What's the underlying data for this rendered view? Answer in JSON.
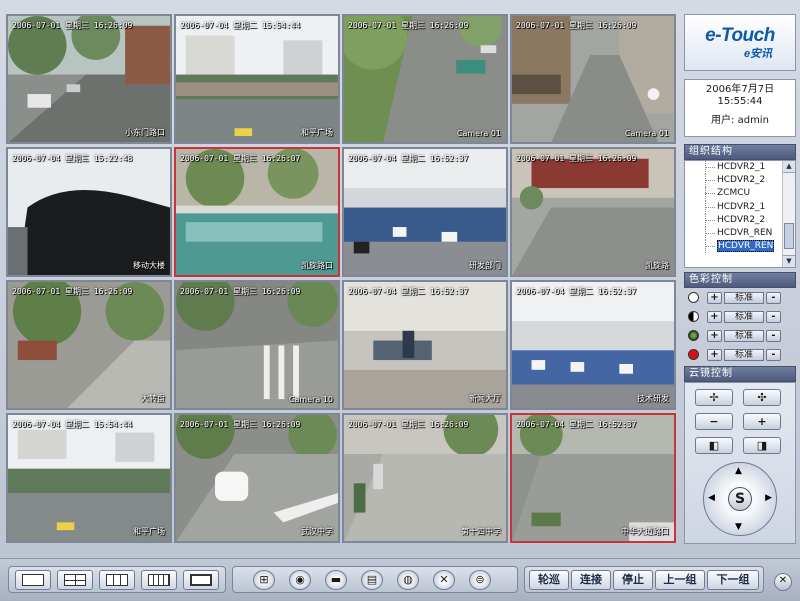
{
  "cameras": [
    {
      "timestamp": "2006-07-01  星期三  16:26:09",
      "name": "小东门路口"
    },
    {
      "timestamp": "2006-07-04  星期二  15:54:44",
      "name": "和平广场"
    },
    {
      "timestamp": "2006-07-01  星期三  16:26:09",
      "name": "Camera 01"
    },
    {
      "timestamp": "2006-07-01  星期三  16:26:09",
      "name": "Camera 01"
    },
    {
      "timestamp": "2006-07-04  星期三  15:22:48",
      "name": "移动大楼"
    },
    {
      "timestamp": "2006-07-01  星期三  16:26:07",
      "name": "凯旋路口"
    },
    {
      "timestamp": "2006-07-04  星期二  16:52:37",
      "name": "研发部门"
    },
    {
      "timestamp": "2006-07-01  星期三  16:26:09",
      "name": "凯旋路"
    },
    {
      "timestamp": "2006-07-01  星期三  16:26:09",
      "name": "大转盘"
    },
    {
      "timestamp": "2006-07-01  星期三  16:26:09",
      "name": "Camera 10"
    },
    {
      "timestamp": "2006-07-04  星期二  16:52:37",
      "name": "新闻大厅"
    },
    {
      "timestamp": "2006-07-04  星期二  16:52:37",
      "name": "技术研发"
    },
    {
      "timestamp": "2006-07-04  星期二  15:54:44",
      "name": "和平广场"
    },
    {
      "timestamp": "2006-07-01  星期三  16:26:09",
      "name": "武汉中学"
    },
    {
      "timestamp": "2006-07-01  星期三  16:26:09",
      "name": "第十四中学"
    },
    {
      "timestamp": "2006-07-04  星期二  16:52:37",
      "name": "中华大道路口"
    }
  ],
  "logo": {
    "line1": "e-Touch",
    "line2": "e安讯"
  },
  "info": {
    "date": "2006年7月7日",
    "time": "15:55:44",
    "user": "用户: admin"
  },
  "tree": {
    "title": "组织结构",
    "items": [
      "HCDVR2_1",
      "HCDVR2_2",
      "ZCMCU",
      "HCDVR2_1",
      "HCDVR2_2",
      "HCDVR_REN",
      "HCDVR_REN"
    ],
    "selected_index": 6,
    "scroll_up": "▲",
    "scroll_down": "▼"
  },
  "color_control": {
    "title": "色彩控制",
    "rows": [
      {
        "icon": "brightness-icon",
        "label": "标准"
      },
      {
        "icon": "contrast-icon",
        "label": "标准"
      },
      {
        "icon": "saturation-icon",
        "label": "标准"
      },
      {
        "icon": "hue-icon",
        "label": "标准"
      }
    ],
    "minus": "-",
    "plus": "+"
  },
  "ptz": {
    "title": "云镜控制",
    "zoom_out": "✢",
    "zoom_in": "✣",
    "focus_minus": "−",
    "focus_plus": "+",
    "iris_close": "◧",
    "iris_open": "◨",
    "arrow_up": "▲",
    "arrow_down": "▼",
    "arrow_left": "◀",
    "arrow_right": "▶",
    "center": "S"
  },
  "bottom": {
    "layout_buttons": [
      "layout-1x1",
      "layout-2x2",
      "layout-3x3",
      "layout-4x4",
      "layout-fullscreen"
    ],
    "tool_icons": [
      "record-icon",
      "snapshot-icon",
      "folder-icon",
      "playback-icon",
      "audio-icon",
      "settings-icon",
      "exit-icon"
    ],
    "actions": [
      "轮巡",
      "连接",
      "停止",
      "上一组",
      "下一组"
    ],
    "close": "✕"
  },
  "colors": {
    "panel_title": "#5a6888",
    "selected_border": "#c9333a",
    "highlight": "#316ac5"
  }
}
